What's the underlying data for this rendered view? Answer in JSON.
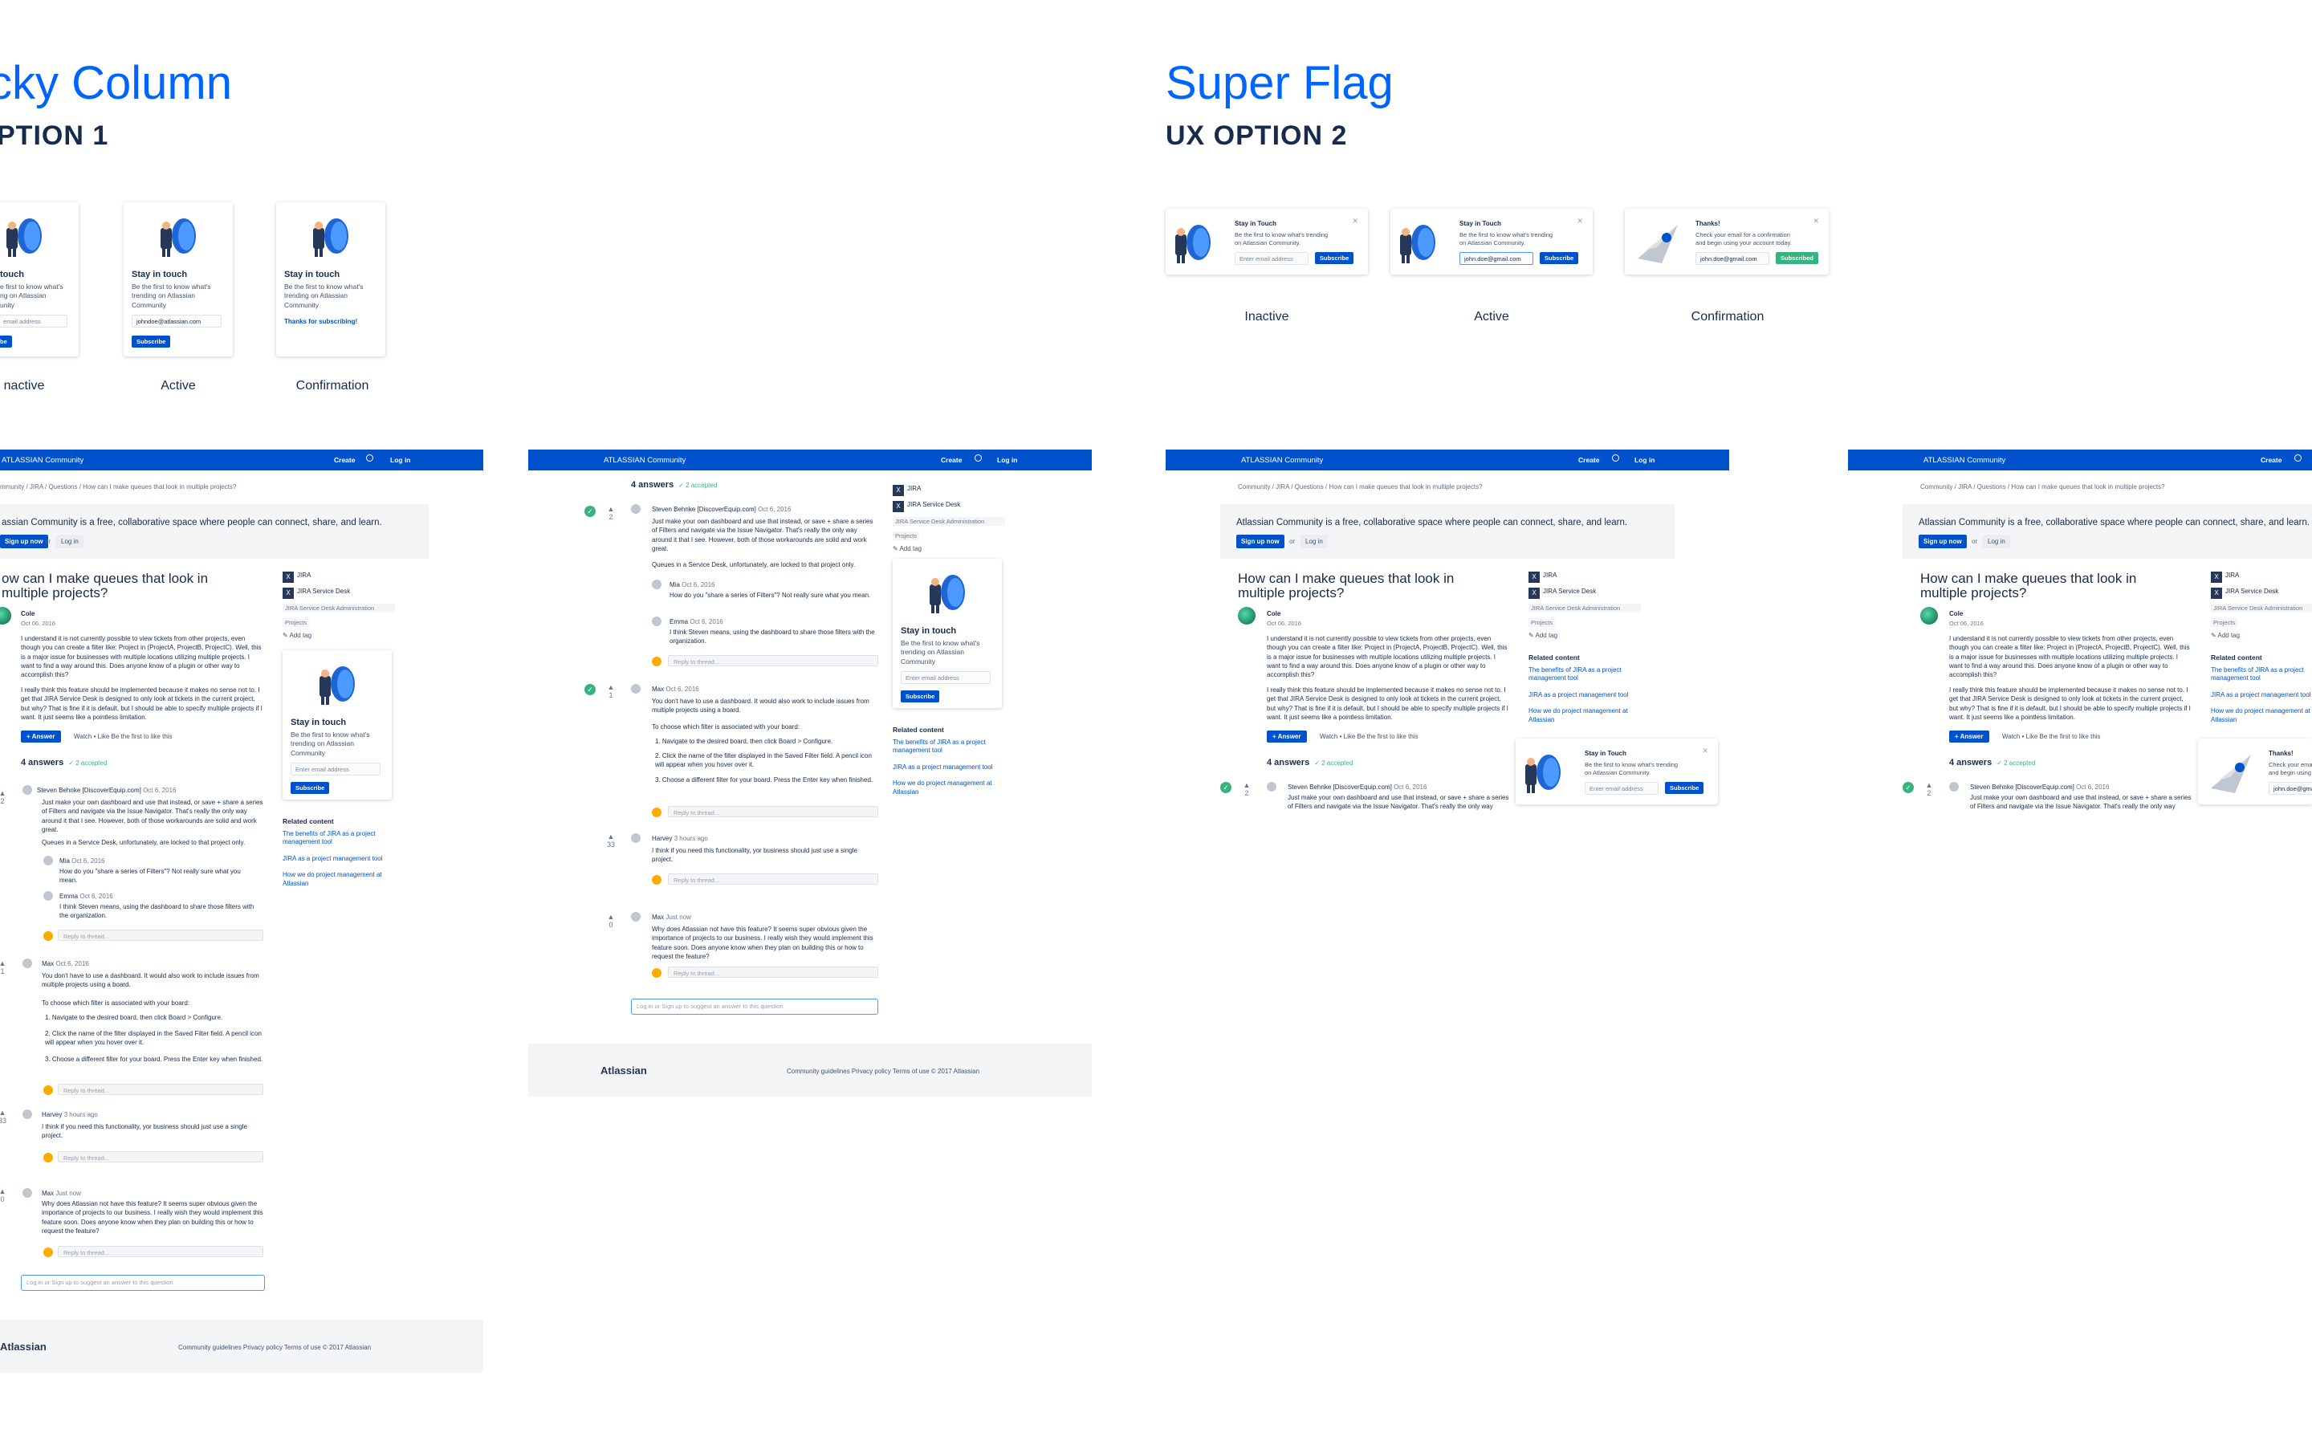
{
  "left_section": {
    "title": "cky Column",
    "subtitle": "PTION 1",
    "cards": {
      "inactive": {
        "title": "touch",
        "text": "e first to know what's\nng on Atlassian\nunity",
        "placeholder": "email address",
        "button": "be"
      },
      "active": {
        "title": "Stay in touch",
        "text": "Be the first to know what's\ntrending on Atlassian\nCommunity",
        "value": "johndoe@atlassian.com",
        "button": "Subscribe"
      },
      "confirmation": {
        "title": "Stay in touch",
        "text": "Be the first to know what's\ntrending on Atlassian\nCommunity",
        "thanks": "Thanks for subscribing!"
      }
    },
    "labels": [
      "nactive",
      "Active",
      "Confirmation"
    ]
  },
  "right_section": {
    "title": "Super Flag",
    "subtitle": "UX OPTION 2",
    "cards": {
      "inactive": {
        "title": "Stay in Touch",
        "text": "Be the first to know what's trending\non Atlassian Community.",
        "placeholder": "Enter email address",
        "button": "Subscribe"
      },
      "active": {
        "title": "Stay in Touch",
        "text": "Be the first to know what's trending\non Atlassian Community.",
        "value": "john.doe@gmail.com",
        "button": "Subscribe"
      },
      "confirmation": {
        "title": "Thanks!",
        "text": "Check your email for a confirmation\nand begin using your account today.",
        "value": "john.doe@gmail.com",
        "button": "Subscribed"
      }
    },
    "labels": [
      "Inactive",
      "Active",
      "Confirmation"
    ]
  },
  "nav": {
    "brand": "ATLASSIAN",
    "brand_sub": "Community",
    "create": "Create",
    "login": "Log in"
  },
  "breadcrumb": "Community / JIRA / Questions / How can I make queues that look in multiple projects?",
  "breadcrumb_cut": "mmunity / JIRA / Questions / How can I make queues that look in multiple projects?",
  "banner": {
    "text": "Atlassian Community is a free, collaborative space where people can connect, share, and learn.",
    "text_cut": "assian Community is a free, collaborative space where people can connect, share, and learn.",
    "signup": "Sign up now",
    "or": "or",
    "login": "Log in"
  },
  "question": {
    "title": "How can I make queues that look in multiple projects?",
    "title_cut": "ow can I make queues that look in\nmultiple projects?",
    "author": "Cole",
    "date": "Oct 06, 2016",
    "p1": "I understand it is not currently possible to view tickets from other projects, even though you can create a filter like: Project in (ProjectA, ProjectB, ProjectC). Well, this is a major issue for businesses with multiple locations utilizing multiple projects. I want to find a way around this. Does anyone know of a plugin or other way to accomplish this?",
    "p2": "I really think this feature should be implemented because it makes no sense not to. I get that JIRA Service Desk is designed to only look at tickets in the current project, but why? That is fine if it is default, but I should be able to specify multiple projects if I want. It just seems like a pointless limitation.",
    "answer_btn": "+ Answer",
    "actions": "Watch •   Like     Be the first to like this"
  },
  "answers": {
    "heading": "4 answers",
    "accepted": "✓ 2 accepted",
    "a1": {
      "author": "Steven Behnke [DiscoverEquip.com]",
      "date": "Oct 6, 2016",
      "votes": "2",
      "text": "Just make your own dashboard and use that instead, or save + share a series of Filters and navigate via the Issue Navigator. That's really the only way around it that I see. However, both of those workarounds are solid and work great.",
      "text2": "Queues in a Service Desk, unfortunately, are locked to that project only."
    },
    "c1": {
      "author": "Mia",
      "date": "Oct 6, 2016",
      "text": "How do you \"share a series of Filters\"? Not really sure what you mean."
    },
    "c2": {
      "author": "Emma",
      "date": "Oct 6, 2016",
      "text": "I think Steven means, using the dashboard to share those filters with the organization."
    },
    "reply": "Reply to thread...",
    "a2": {
      "author": "Max",
      "date": "Oct 6, 2016",
      "votes": "1",
      "text": "You don't have to use a dashboard. It would also work to include issues from multiple projects using a board.",
      "text2": "To choose which filter is associated with your board:",
      "steps": [
        "1.   Navigate to the desired board, then click Board > Configure.",
        "2.   Click the name of the filter displayed in the Saved Filter field. A pencil icon will appear when you hover over it.",
        "3.   Choose a different filter for your board. Press the Enter key when finished."
      ]
    },
    "a3": {
      "author": "Harvey",
      "date": "3 hours ago",
      "votes": "33",
      "text": "I think if you need this functionality, yor business should just use a single project."
    },
    "a4": {
      "author": "Max",
      "date": "Just now",
      "votes": "0",
      "text": "Why does Atlassian not have this feature? It seems super obvious given the importance of projects to our business. I really wish they would implement this feature soon. Does anyone know when they plan on building this or how to request the feature?"
    },
    "comment_box": "Log in or Sign up to suggest an answer to this question"
  },
  "sidebar": {
    "tag1": "JIRA",
    "tag2": "JIRA Service Desk",
    "subtag1": "JIRA Service Desk Administration",
    "subtag2": "Projects",
    "add_tag": "Add tag",
    "related_h": "Related content",
    "related": [
      "The benefits of JIRA as a project management tool",
      "JIRA as a project management tool",
      "How we do project management at Atlassian"
    ]
  },
  "footer": {
    "logo": "Atlassian",
    "links": "Community guidelines     Privacy policy     Terms of use     © 2017 Atlassian"
  },
  "colors": {
    "primary": "#0052cc",
    "accent": "#0065ff",
    "success": "#36b37e",
    "text": "#172b4d"
  }
}
